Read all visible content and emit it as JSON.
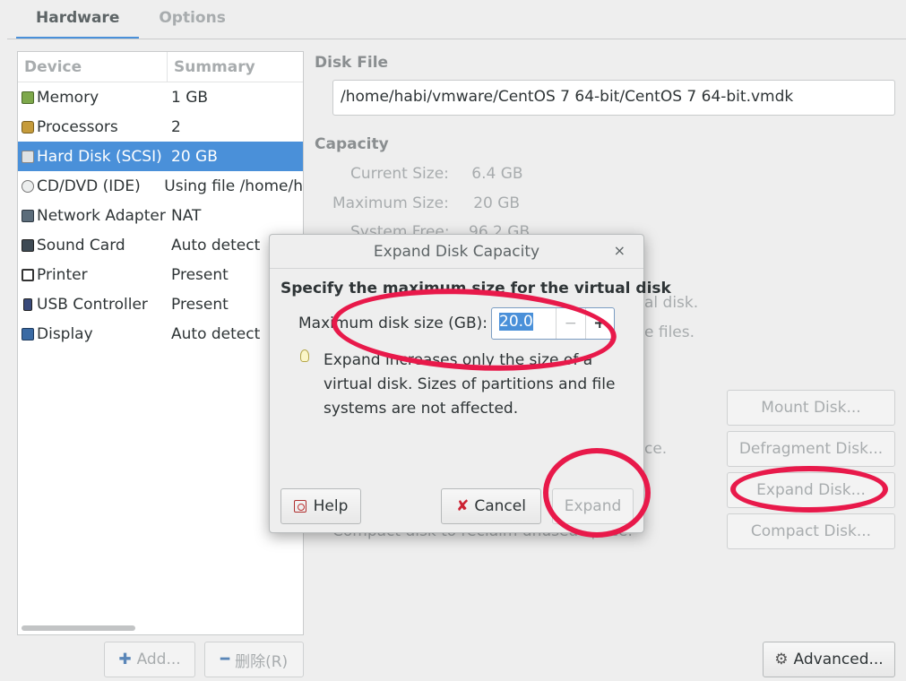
{
  "tabs": [
    {
      "label": "Hardware",
      "active": true
    },
    {
      "label": "Options",
      "active": false
    }
  ],
  "device_list": {
    "headers": {
      "device": "Device",
      "summary": "Summary"
    },
    "rows": [
      {
        "icon": "memory-icon",
        "device": "Memory",
        "summary": "1 GB"
      },
      {
        "icon": "processor-icon",
        "device": "Processors",
        "summary": "2"
      },
      {
        "icon": "hard-disk-icon",
        "device": "Hard Disk (SCSI)",
        "summary": "20 GB",
        "selected": true
      },
      {
        "icon": "cd-dvd-icon",
        "device": "CD/DVD (IDE)",
        "summary": "Using file /home/h"
      },
      {
        "icon": "network-adapter-icon",
        "device": "Network Adapter",
        "summary": "NAT"
      },
      {
        "icon": "sound-card-icon",
        "device": "Sound Card",
        "summary": "Auto detect"
      },
      {
        "icon": "printer-icon",
        "device": "Printer",
        "summary": "Present"
      },
      {
        "icon": "usb-icon",
        "device": "USB Controller",
        "summary": "Present"
      },
      {
        "icon": "display-icon",
        "device": "Display",
        "summary": "Auto detect"
      }
    ]
  },
  "buttons": {
    "add": "Add...",
    "remove": "删除(R)",
    "advanced": "Advanced...",
    "mount_disk": "Mount Disk...",
    "defragment_disk": "Defragment Disk...",
    "expand_disk": "Expand Disk...",
    "compact_disk": "Compact Disk..."
  },
  "disk": {
    "file_label": "Disk File",
    "file_path": "/home/habi/vmware/CentOS 7 64-bit/CentOS 7 64-bit.vmdk",
    "capacity_label": "Capacity",
    "current_size_label": "Current Size:",
    "current_size": "6.4 GB",
    "maximum_size_label": "Maximum Size:",
    "maximum_size": "20 GB",
    "system_free_label": "System Free:",
    "system_free": "96.2 GB",
    "bg_text_1": "al disk.",
    "bg_text_2": "e files.",
    "bg_text_3": "ce.",
    "bg_text_4": "Compact disk to reclaim unused space."
  },
  "dialog": {
    "title": "Expand Disk Capacity",
    "close": "×",
    "heading": "Specify the maximum size for the virtual disk",
    "size_label": "Maximum disk size (GB):",
    "size_value": "20.0",
    "minus": "−",
    "plus": "+",
    "note": "Expand increases only the size of a virtual disk. Sizes of partitions and file systems are not affected.",
    "help": "Help",
    "cancel": "Cancel",
    "expand": "Expand"
  },
  "colors": {
    "accent": "#4a90d9",
    "annotation": "#e8194a"
  }
}
